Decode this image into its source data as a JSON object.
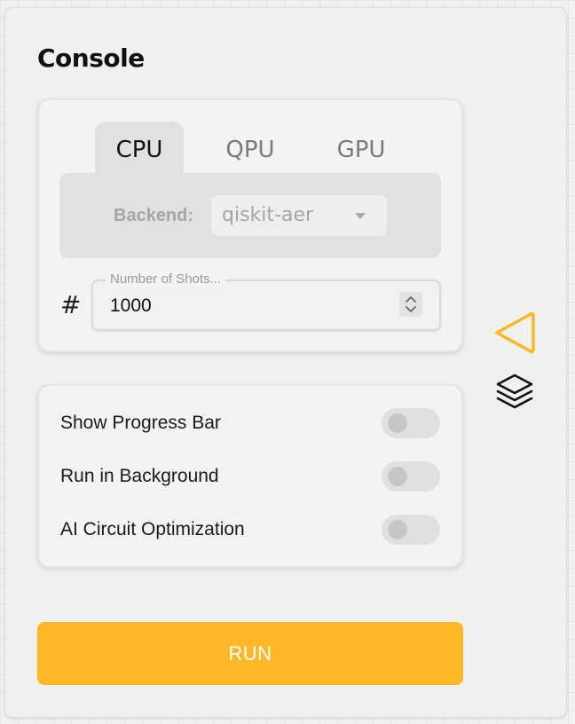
{
  "console": {
    "title": "Console"
  },
  "tabs": [
    {
      "label": "CPU",
      "active": true
    },
    {
      "label": "QPU",
      "active": false
    },
    {
      "label": "GPU",
      "active": false
    }
  ],
  "backend": {
    "label": "Backend:",
    "value": "qiskit-aer"
  },
  "shots": {
    "prefix": "#",
    "label": "Number of Shots...",
    "value": "1000"
  },
  "options": [
    {
      "label": "Show Progress Bar",
      "enabled": false
    },
    {
      "label": "Run in Background",
      "enabled": false
    },
    {
      "label": "AI Circuit Optimization",
      "enabled": false
    }
  ],
  "run_button": {
    "label": "RUN"
  },
  "side_icons": {
    "collapse": "triangle-left-icon",
    "layers": "layers-icon"
  },
  "colors": {
    "accent": "#fdb727",
    "collapse_icon": "#fdb727"
  }
}
